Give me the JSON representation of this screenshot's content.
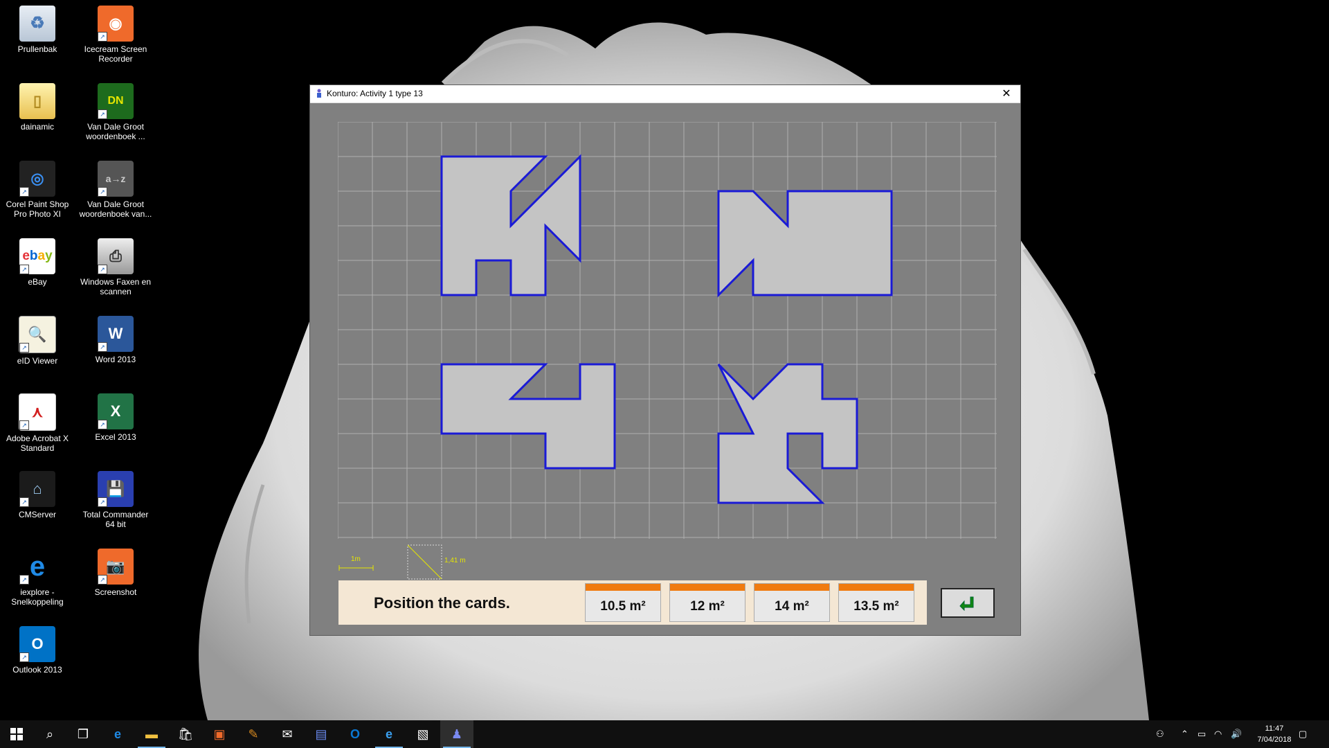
{
  "desktop": {
    "icons": [
      {
        "label": "Prullenbak"
      },
      {
        "label": "Icecream Screen Recorder"
      },
      {
        "label": "dainamic"
      },
      {
        "label": "Van Dale Groot woordenboek ..."
      },
      {
        "label": "Corel Paint Shop Pro Photo XI"
      },
      {
        "label": "Van Dale Groot woordenboek van..."
      },
      {
        "label": "eBay"
      },
      {
        "label": "Windows Faxen en scannen"
      },
      {
        "label": "eID Viewer"
      },
      {
        "label": "Word 2013"
      },
      {
        "label": "Adobe Acrobat X Standard"
      },
      {
        "label": "Excel 2013"
      },
      {
        "label": "CMServer"
      },
      {
        "label": "Total Commander 64 bit"
      },
      {
        "label": "iexplore - Snelkoppeling"
      },
      {
        "label": "Screenshot"
      },
      {
        "label": "Outlook 2013"
      }
    ]
  },
  "window": {
    "title": "Konturo: Activity 1 type 13",
    "close_glyph": "✕",
    "scale": {
      "unit_label": "1m",
      "diagonal_label": "1,41 m"
    },
    "instruction": "Position the cards.",
    "cards": [
      {
        "label": "10.5 m²"
      },
      {
        "label": "12 m²"
      },
      {
        "label": "14 m²"
      },
      {
        "label": "13.5 m²"
      }
    ],
    "colors": {
      "shape_fill": "#c4c4c4",
      "shape_stroke": "#1a1ad6",
      "grid_bg": "#808080",
      "card_accent": "#f07b10",
      "enter_arrow": "#118811"
    }
  },
  "taskbar": {
    "clock_time": "11:47",
    "clock_date": "7/04/2018"
  }
}
